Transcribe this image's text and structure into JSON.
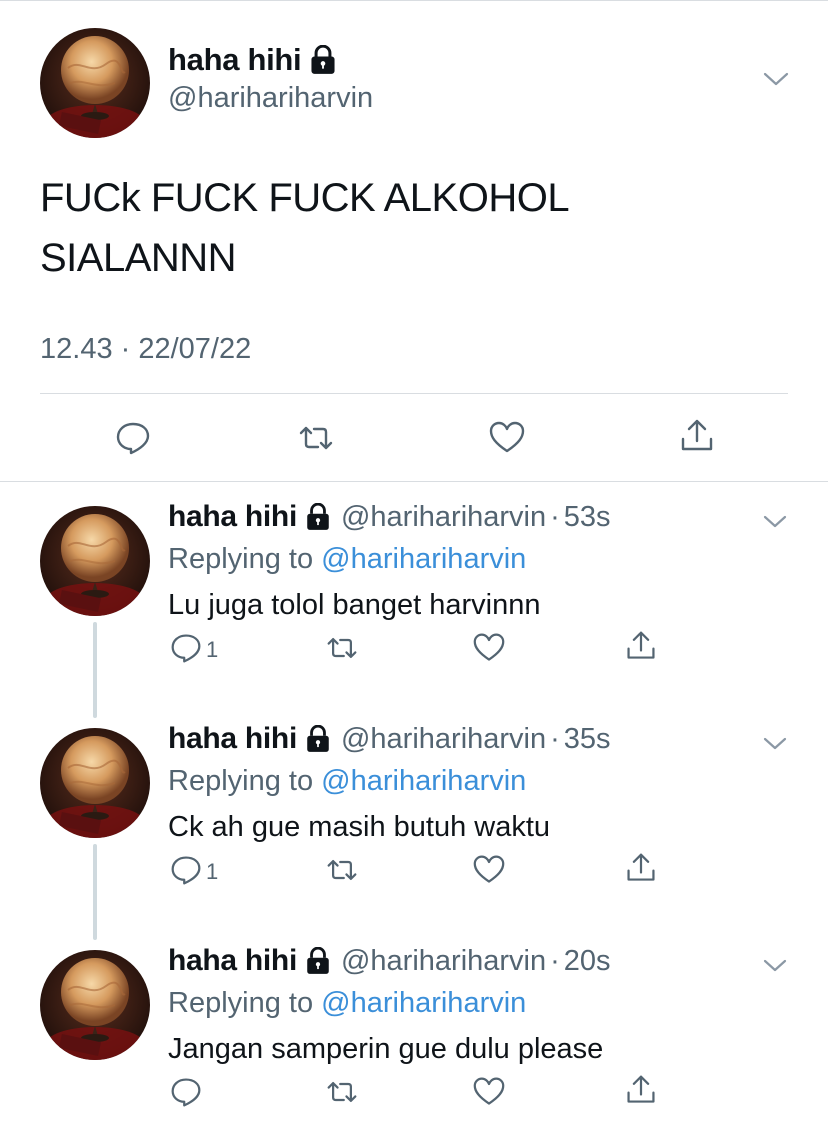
{
  "main_tweet": {
    "display_name": "haha hihi",
    "handle": "@harihariharvin",
    "text_line1": "FUCk FUCK FUCK ALKOHOL",
    "text_line2": "SIALANNN",
    "timestamp": "12.43 · 22/07/22",
    "icons": [
      "reply-icon",
      "retweet-icon",
      "like-icon",
      "share-icon",
      "lock-icon",
      "chevron-down-icon"
    ]
  },
  "replies": [
    {
      "display_name": "haha hihi",
      "handle": "@harihariharvin",
      "separator": "·",
      "time": "53s",
      "replying_prefix": "Replying to",
      "replying_to": "@harihariharvin",
      "text": "Lu juga tolol banget harvinnn",
      "reply_count": "1"
    },
    {
      "display_name": "haha hihi",
      "handle": "@harihariharvin",
      "separator": "·",
      "time": "35s",
      "replying_prefix": "Replying to",
      "replying_to": "@harihariharvin",
      "text": "Ck ah gue masih butuh waktu",
      "reply_count": "1"
    },
    {
      "display_name": "haha hihi",
      "handle": "@harihariharvin",
      "separator": "·",
      "time": "20s",
      "replying_prefix": "Replying to",
      "replying_to": "@harihariharvin",
      "text": "Jangan samperin gue dulu please",
      "reply_count": ""
    }
  ],
  "colors": {
    "text": "#0f1419",
    "secondary": "#536471",
    "link": "#3b8fd9",
    "divider": "#d9dde1",
    "thread_line": "#cfd9de"
  }
}
